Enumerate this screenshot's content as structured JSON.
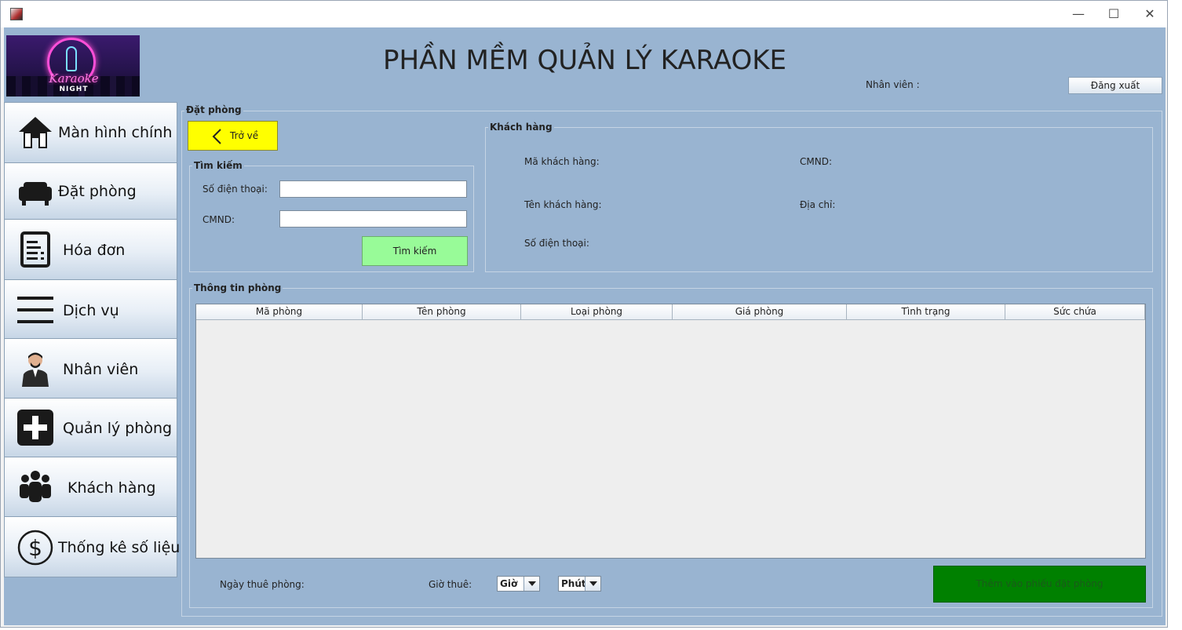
{
  "window": {
    "minimize_glyph": "—",
    "maximize_glyph": "☐",
    "close_glyph": "✕"
  },
  "header": {
    "logo": {
      "word": "Karaoke",
      "night": "NIGHT"
    },
    "title": "PHẦN MỀM QUẢN LÝ KARAOKE",
    "staff_label": "Nhân viên :",
    "logout_label": "Đăng xuất"
  },
  "sidebar": {
    "items": [
      {
        "label": "Màn hình chính",
        "icon": "home-icon"
      },
      {
        "label": "Đặt phòng",
        "icon": "sofa-icon"
      },
      {
        "label": "Hóa đơn",
        "icon": "invoice-icon"
      },
      {
        "label": "Dịch vụ",
        "icon": "menu-lines-icon"
      },
      {
        "label": "Nhân viên",
        "icon": "employee-icon"
      },
      {
        "label": "Quản lý phòng",
        "icon": "plus-box-icon"
      },
      {
        "label": "Khách hàng",
        "icon": "group-icon"
      },
      {
        "label": "Thống kê số liệu",
        "icon": "dollar-circle-icon"
      }
    ]
  },
  "booking": {
    "legend": "Đặt phòng",
    "back_label": "Trở về",
    "search": {
      "legend": "Tìm kiếm",
      "phone_label": "Số điện thoại:",
      "phone_value": "",
      "id_label": "CMND:",
      "id_value": "",
      "button_label": "Tìm kiếm"
    },
    "customer": {
      "legend": "Khách hàng",
      "code_label": "Mã khách hàng:",
      "id_label": "CMND:",
      "name_label": "Tên khách hàng:",
      "address_label": "Địa chỉ:",
      "phone_label": "Số điện thoại:"
    },
    "rooms": {
      "legend": "Thông tin phòng",
      "columns": [
        "Mã phòng",
        "Tên phòng",
        "Loại phòng",
        "Giá phòng",
        "Tình trạng",
        "Sức chứa"
      ],
      "rows": []
    },
    "footer": {
      "date_label": "Ngày thuê phòng:",
      "time_label": "Giờ thuê:",
      "hour_value": "Giờ",
      "minute_value": "Phút",
      "add_button_label": "Thêm vào phiếu đặt phòng"
    }
  }
}
